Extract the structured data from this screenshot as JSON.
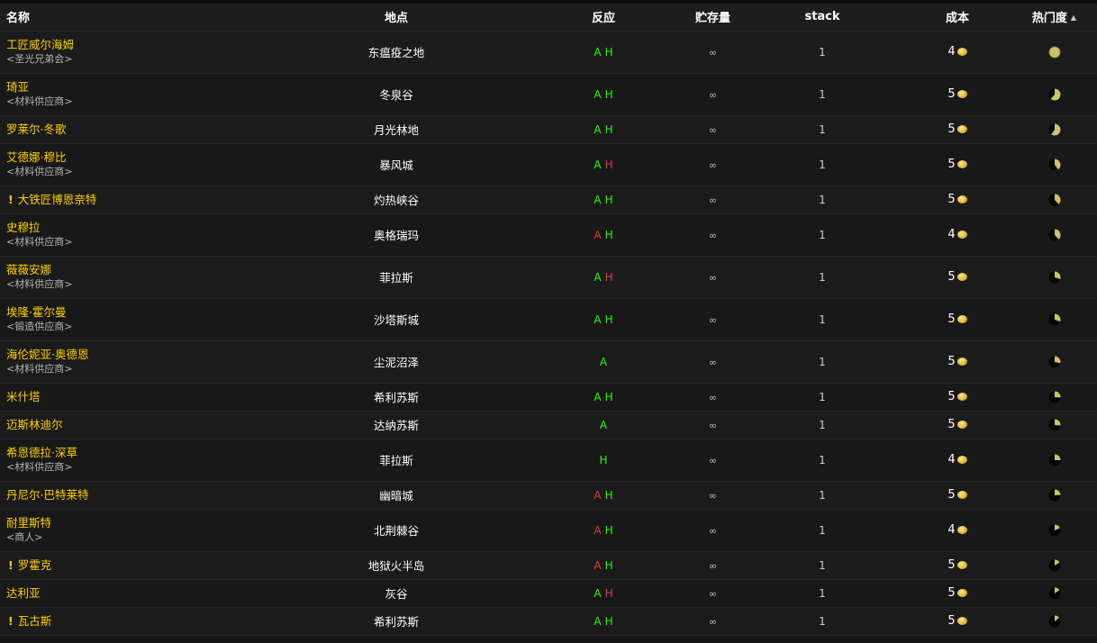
{
  "headers": {
    "name": "名称",
    "location": "地点",
    "react": "反应",
    "stock": "贮存量",
    "stack": "stack",
    "cost": "成本",
    "popularity": "热门度",
    "sort_indicator": "▲"
  },
  "colors": {
    "npc_name": "#ffd100",
    "friendly": "#1eff00",
    "hostile": "#e03a3a",
    "coin": "#e2b73a",
    "pie_fill": "#cdc26a"
  },
  "rows": [
    {
      "name": "工匠威尔海姆",
      "subtitle": "<圣光兄弟会>",
      "quest": false,
      "location": "东瘟疫之地",
      "alliance": "A",
      "alliance_hostile": false,
      "horde": "H",
      "horde_hostile": false,
      "stock": "∞",
      "stack": "1",
      "cost": "4",
      "popularity": 1.0
    },
    {
      "name": "琦亚",
      "subtitle": "<材料供应商>",
      "quest": false,
      "location": "冬泉谷",
      "alliance": "A",
      "alliance_hostile": false,
      "horde": "H",
      "horde_hostile": false,
      "stock": "∞",
      "stack": "1",
      "cost": "5",
      "popularity": 0.62
    },
    {
      "name": "罗莱尔·冬歌",
      "subtitle": "",
      "quest": false,
      "location": "月光林地",
      "alliance": "A",
      "alliance_hostile": false,
      "horde": "H",
      "horde_hostile": false,
      "stock": "∞",
      "stack": "1",
      "cost": "5",
      "popularity": 0.6
    },
    {
      "name": "艾德娜·穆比",
      "subtitle": "<材料供应商>",
      "quest": false,
      "location": "暴风城",
      "alliance": "A",
      "alliance_hostile": false,
      "horde": "H",
      "horde_hostile": true,
      "stock": "∞",
      "stack": "1",
      "cost": "5",
      "popularity": 0.4
    },
    {
      "name": "大铁匠博恩奈特",
      "subtitle": "",
      "quest": true,
      "location": "灼热峡谷",
      "alliance": "A",
      "alliance_hostile": false,
      "horde": "H",
      "horde_hostile": false,
      "stock": "∞",
      "stack": "1",
      "cost": "5",
      "popularity": 0.38
    },
    {
      "name": "史穆拉",
      "subtitle": "<材料供应商>",
      "quest": false,
      "location": "奥格瑞玛",
      "alliance": "A",
      "alliance_hostile": true,
      "horde": "H",
      "horde_hostile": false,
      "stock": "∞",
      "stack": "1",
      "cost": "4",
      "popularity": 0.38
    },
    {
      "name": "薇薇安娜",
      "subtitle": "<材料供应商>",
      "quest": false,
      "location": "菲拉斯",
      "alliance": "A",
      "alliance_hostile": false,
      "horde": "H",
      "horde_hostile": true,
      "stock": "∞",
      "stack": "1",
      "cost": "5",
      "popularity": 0.3
    },
    {
      "name": "埃隆·霍尔曼",
      "subtitle": "<锻造供应商>",
      "quest": false,
      "location": "沙塔斯城",
      "alliance": "A",
      "alliance_hostile": false,
      "horde": "H",
      "horde_hostile": false,
      "stock": "∞",
      "stack": "1",
      "cost": "5",
      "popularity": 0.3
    },
    {
      "name": "海伦妮亚·奥德恩",
      "subtitle": "<材料供应商>",
      "quest": false,
      "location": "尘泥沼泽",
      "alliance": "A",
      "alliance_hostile": false,
      "horde": "",
      "horde_hostile": false,
      "stock": "∞",
      "stack": "1",
      "cost": "5",
      "popularity": 0.28
    },
    {
      "name": "米什塔",
      "subtitle": "",
      "quest": false,
      "location": "希利苏斯",
      "alliance": "A",
      "alliance_hostile": false,
      "horde": "H",
      "horde_hostile": false,
      "stock": "∞",
      "stack": "1",
      "cost": "5",
      "popularity": 0.26
    },
    {
      "name": "迈斯林迪尔",
      "subtitle": "",
      "quest": false,
      "location": "达纳苏斯",
      "alliance": "A",
      "alliance_hostile": false,
      "horde": "",
      "horde_hostile": false,
      "stock": "∞",
      "stack": "1",
      "cost": "5",
      "popularity": 0.26
    },
    {
      "name": "希恩德拉·深草",
      "subtitle": "<材料供应商>",
      "quest": false,
      "location": "菲拉斯",
      "alliance": "",
      "alliance_hostile": false,
      "horde": "H",
      "horde_hostile": false,
      "stock": "∞",
      "stack": "1",
      "cost": "4",
      "popularity": 0.25
    },
    {
      "name": "丹尼尔·巴特莱特",
      "subtitle": "",
      "quest": false,
      "location": "幽暗城",
      "alliance": "A",
      "alliance_hostile": true,
      "horde": "H",
      "horde_hostile": false,
      "stock": "∞",
      "stack": "1",
      "cost": "5",
      "popularity": 0.24
    },
    {
      "name": "耐里斯特",
      "subtitle": "<商人>",
      "quest": false,
      "location": "北荆棘谷",
      "alliance": "A",
      "alliance_hostile": true,
      "horde": "H",
      "horde_hostile": false,
      "stock": "∞",
      "stack": "1",
      "cost": "4",
      "popularity": 0.18
    },
    {
      "name": "罗霍克",
      "subtitle": "",
      "quest": true,
      "location": "地狱火半岛",
      "alliance": "A",
      "alliance_hostile": true,
      "horde": "H",
      "horde_hostile": false,
      "stock": "∞",
      "stack": "1",
      "cost": "5",
      "popularity": 0.16
    },
    {
      "name": "达利亚",
      "subtitle": "",
      "quest": false,
      "location": "灰谷",
      "alliance": "A",
      "alliance_hostile": false,
      "horde": "H",
      "horde_hostile": true,
      "stock": "∞",
      "stack": "1",
      "cost": "5",
      "popularity": 0.15
    },
    {
      "name": "瓦古斯",
      "subtitle": "",
      "quest": true,
      "location": "希利苏斯",
      "alliance": "A",
      "alliance_hostile": false,
      "horde": "H",
      "horde_hostile": false,
      "stock": "∞",
      "stack": "1",
      "cost": "5",
      "popularity": 0.14
    }
  ]
}
